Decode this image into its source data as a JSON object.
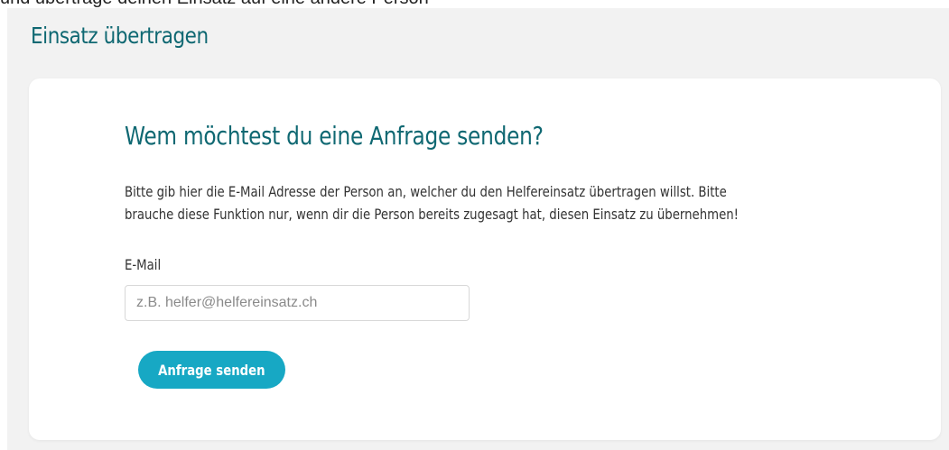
{
  "top_text": "und übertrage deinen Einsatz auf eine andere Person",
  "page_title": "Einsatz übertragen",
  "card": {
    "heading": "Wem möchtest du eine Anfrage senden?",
    "description_line1": "Bitte gib hier die E-Mail Adresse der Person an, welcher du den Helfereinsatz übertragen willst. Bitte",
    "description_line2": "brauche diese Funktion nur, wenn dir die Person bereits zugesagt hat, diesen Einsatz zu übernehmen!",
    "email": {
      "label": "E-Mail",
      "placeholder": "z.B. helfer@helfereinsatz.ch",
      "value": ""
    },
    "submit_label": "Anfrage senden"
  },
  "colors": {
    "heading": "#0f6872",
    "button": "#17a8c4",
    "panel_background": "#f2f2f2",
    "card_background": "#ffffff"
  }
}
